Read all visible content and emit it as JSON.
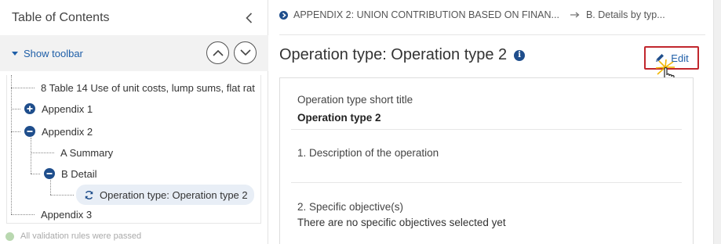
{
  "toc": {
    "title": "Table of Contents",
    "show_toolbar": "Show toolbar",
    "items": [
      {
        "label": "8 Table 14 Use of unit costs, lump sums, flat rat"
      },
      {
        "label": "Appendix 1"
      },
      {
        "label": "Appendix 2"
      },
      {
        "label": "A Summary"
      },
      {
        "label": "B Detail"
      },
      {
        "label": "Operation type: Operation type 2"
      },
      {
        "label": "Appendix 3"
      }
    ],
    "validation": "All validation rules were passed"
  },
  "breadcrumb": {
    "first": "APPENDIX 2: UNION CONTRIBUTION BASED ON FINAN...",
    "second": "B. Details by typ..."
  },
  "page": {
    "title": "Operation type: Operation type 2",
    "edit_label": "Edit"
  },
  "form": {
    "short_title_label": "Operation type short title",
    "short_title_value": "Operation type 2",
    "description_label": "1. Description of the operation",
    "objectives_label": "2. Specific objective(s)",
    "objectives_value": "There are no specific objectives selected yet"
  },
  "colors": {
    "accent": "#1f4e8c",
    "link": "#1f5fa8",
    "highlight_border": "#c1272d"
  }
}
